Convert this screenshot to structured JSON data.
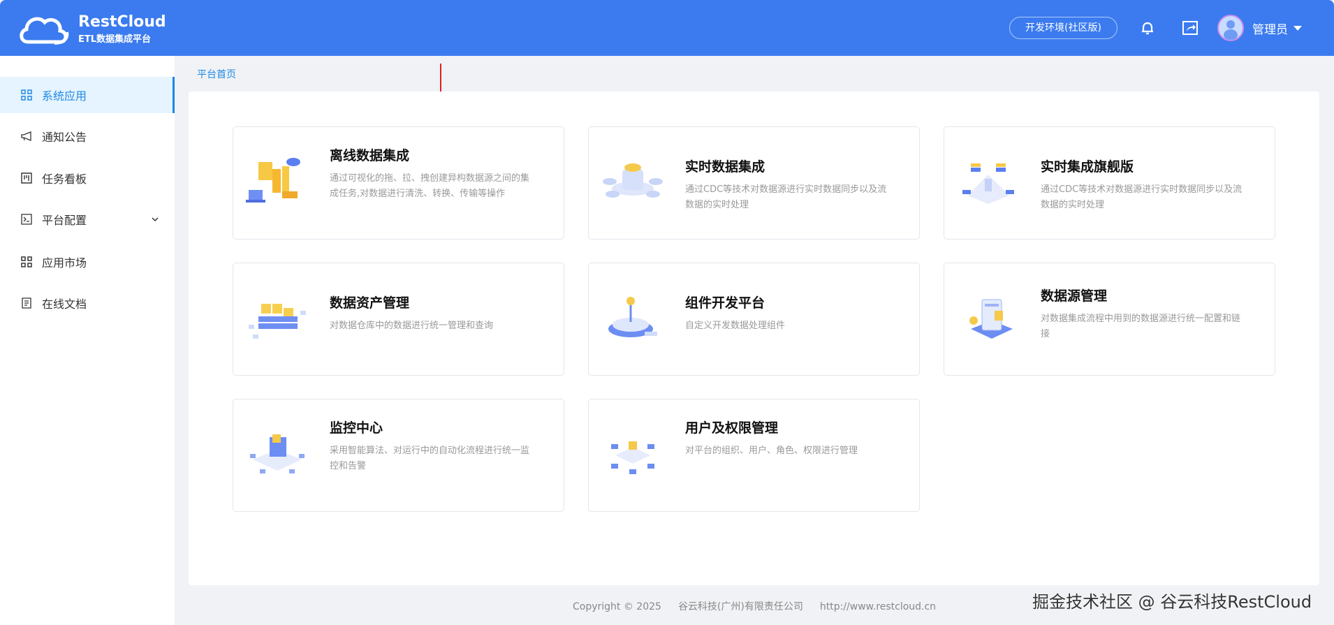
{
  "header": {
    "logo_title": "RestCloud",
    "logo_subtitle": "ETL数据集成平台",
    "env_label": "开发环境(社区版)",
    "user_name": "管理员"
  },
  "sidebar": {
    "items": [
      {
        "label": "系统应用",
        "icon": "grid-icon",
        "active": true
      },
      {
        "label": "通知公告",
        "icon": "megaphone-icon"
      },
      {
        "label": "任务看板",
        "icon": "kanban-icon"
      },
      {
        "label": "平台配置",
        "icon": "terminal-icon",
        "expandable": true
      },
      {
        "label": "应用市场",
        "icon": "grid-icon"
      },
      {
        "label": "在线文档",
        "icon": "document-icon"
      }
    ]
  },
  "breadcrumb": "平台首页",
  "cards": [
    {
      "title": "离线数据集成",
      "desc": "通过可视化的拖、拉、拽创建异构数据源之间的集成任务,对数据进行清洗、转换、传输等操作"
    },
    {
      "title": "实时数据集成",
      "desc": "通过CDC等技术对数据源进行实时数据同步以及流数据的实时处理"
    },
    {
      "title": "实时集成旗舰版",
      "desc": "通过CDC等技术对数据源进行实时数据同步以及流数据的实时处理"
    },
    {
      "title": "数据资产管理",
      "desc": "对数据仓库中的数据进行统一管理和查询"
    },
    {
      "title": "组件开发平台",
      "desc": "自定义开发数据处理组件"
    },
    {
      "title": "数据源管理",
      "desc": "对数据集成流程中用到的数据源进行统一配置和链接"
    },
    {
      "title": "监控中心",
      "desc": "采用智能算法、对运行中的自动化流程进行统一监控和告警"
    },
    {
      "title": "用户及权限管理",
      "desc": "对平台的组织、用户、角色、权限进行管理"
    }
  ],
  "footer": {
    "copyright": "Copyright © 2025",
    "company": "谷云科技(广州)有限责任公司",
    "url": "http://www.restcloud.cn"
  },
  "watermark": "掘金技术社区 @ 谷云科技RestCloud",
  "colors": {
    "primary": "#3b7bef",
    "accent": "#1e88e5",
    "arrow": "#e02020"
  }
}
